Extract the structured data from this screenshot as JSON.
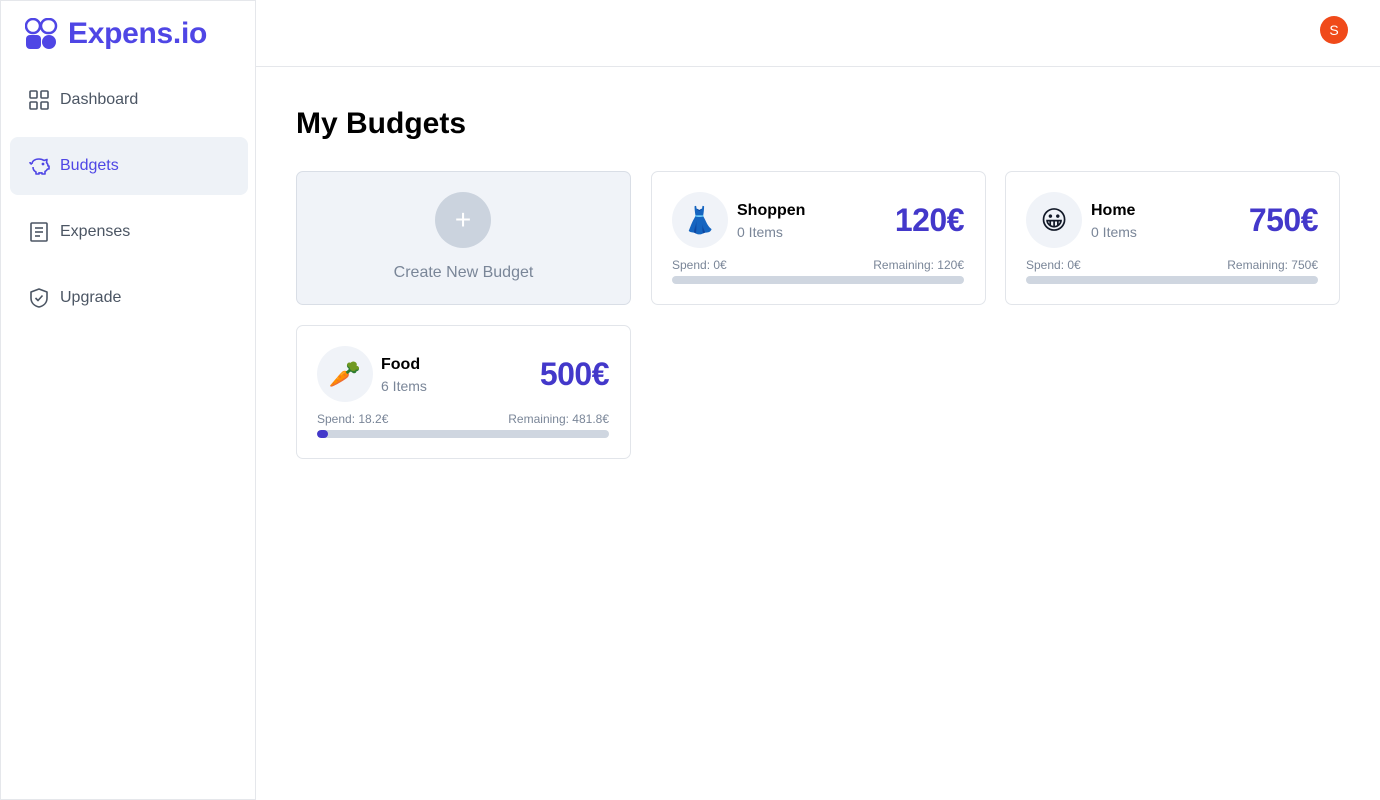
{
  "app": {
    "name": "Expens.io"
  },
  "sidebar": {
    "items": [
      {
        "label": "Dashboard",
        "icon": "grid-icon",
        "active": false
      },
      {
        "label": "Budgets",
        "icon": "piggy-bank-icon",
        "active": true
      },
      {
        "label": "Expenses",
        "icon": "receipt-icon",
        "active": false
      },
      {
        "label": "Upgrade",
        "icon": "shield-check-icon",
        "active": false
      }
    ]
  },
  "header": {
    "avatar_initial": "S"
  },
  "main": {
    "title": "My Budgets",
    "create": {
      "plus": "+",
      "label": "Create New Budget"
    },
    "budgets": [
      {
        "emoji": "👗",
        "name": "Shoppen",
        "items": "0 Items",
        "amount": "120€",
        "spend": "Spend: 0€",
        "remaining": "Remaining: 120€",
        "progress": 0
      },
      {
        "emoji": "😀",
        "name": "Home",
        "items": "0 Items",
        "amount": "750€",
        "spend": "Spend: 0€",
        "remaining": "Remaining: 750€",
        "progress": 0
      },
      {
        "emoji": "🥕",
        "name": "Food",
        "items": "6 Items",
        "amount": "500€",
        "spend": "Spend: 18.2€",
        "remaining": "Remaining: 481.8€",
        "progress": 0.0364
      }
    ]
  },
  "colors": {
    "accent": "#4f46e5",
    "amount": "#4338ca",
    "avatar": "#f04a1a"
  }
}
